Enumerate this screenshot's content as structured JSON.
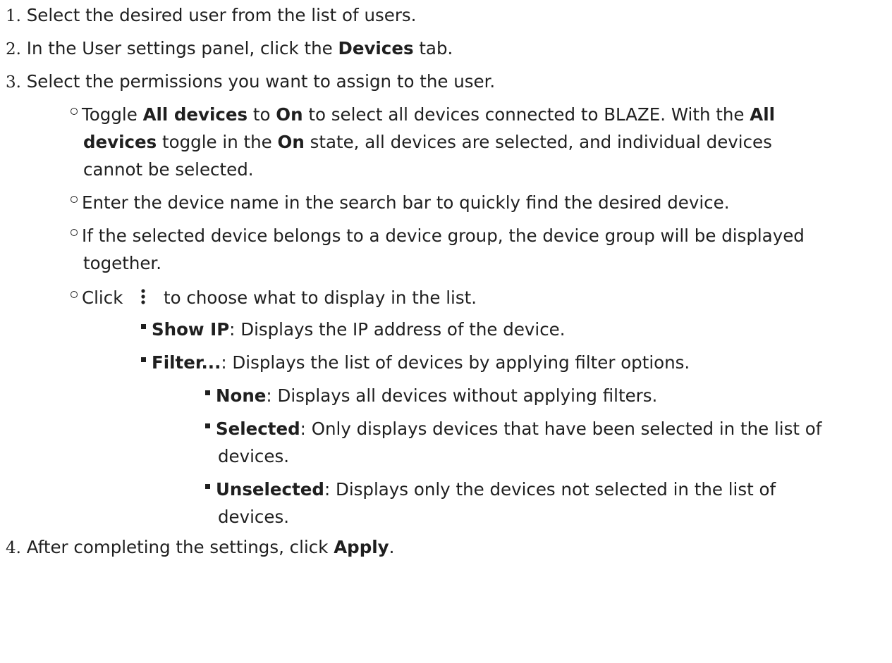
{
  "steps": [
    {
      "num": "1.",
      "text": "Select the desired user from the list of users."
    },
    {
      "num": "2.",
      "pre": "In the User settings panel, click the ",
      "bold": "Devices",
      "post": " tab."
    },
    {
      "num": "3.",
      "text": "Select the permissions you want to assign to the user."
    },
    {
      "num": "4.",
      "pre": "After completing the settings, click ",
      "bold": "Apply",
      "post": "."
    }
  ],
  "sub": {
    "toggle": {
      "t1": "Toggle ",
      "b1": "All devices",
      "t2": " to ",
      "b2": "On",
      "t3": " to select all devices connected to BLAZE. With the ",
      "b3": "All",
      "b4": "devices",
      "t4": " toggle in the ",
      "b5": "On",
      "t5": " state, all devices are selected, and individual devices",
      "t6": "cannot be selected."
    },
    "search": "Enter the device name in the search bar to quickly find the desired device.",
    "group_1": "If the selected device belongs to a device group, the device group will be displayed",
    "group_2": "together.",
    "click_pre": "Click",
    "click_post": "to choose what to display in the list."
  },
  "options": {
    "show_ip": {
      "label": "Show IP",
      "desc": ": Displays the IP address of the device."
    },
    "filter": {
      "label": "Filter...",
      "desc": ": Displays the list of devices by applying filter options."
    }
  },
  "filters": {
    "none": {
      "label": "None",
      "desc": ": Displays all devices without applying filters."
    },
    "selected": {
      "label": "Selected",
      "desc_1": ": Only displays devices that have been selected in the list of",
      "desc_2": "devices."
    },
    "unselected": {
      "label": "Unselected",
      "desc_1": ": Displays only the devices not selected in the list of",
      "desc_2": "devices."
    }
  },
  "icons": {
    "more": "more-vertical-icon"
  }
}
